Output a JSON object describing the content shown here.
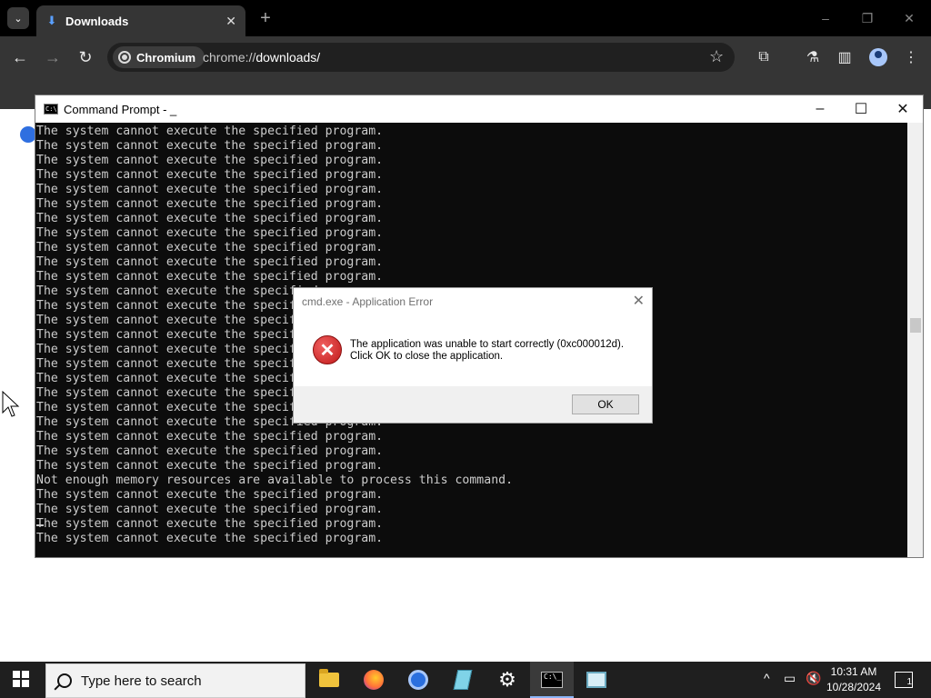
{
  "browser": {
    "tab_title": "Downloads",
    "tab_close": "✕",
    "new_tab": "+",
    "site_chip": "Chromium",
    "url_scheme": "chrome://",
    "url_path": "downloads/"
  },
  "cmd": {
    "title": "Command Prompt - _",
    "icon_text": "C:\\",
    "lines": [
      "The system cannot execute the specified program.",
      "The system cannot execute the specified program.",
      "The system cannot execute the specified program.",
      "The system cannot execute the specified program.",
      "The system cannot execute the specified program.",
      "The system cannot execute the specified program.",
      "The system cannot execute the specified program.",
      "The system cannot execute the specified program.",
      "The system cannot execute the specified program.",
      "The system cannot execute the specified program.",
      "The system cannot execute the specified program.",
      "The system cannot execute the specified program.",
      "The system cannot execute the specified program.",
      "The system cannot execute the specified program.",
      "The system cannot execute the specified program.",
      "The system cannot execute the specified program.",
      "The system cannot execute the specified program.",
      "The system cannot execute the specified program.",
      "The system cannot execute the specified program.",
      "The system cannot execute the specified program.",
      "The system cannot execute the specified program.",
      "The system cannot execute the specified program.",
      "The system cannot execute the specified program.",
      "The system cannot execute the specified program.",
      "Not enough memory resources are available to process this command.",
      "The system cannot execute the specified program.",
      "The system cannot execute the specified program.",
      "The system cannot execute the specified program.",
      "The system cannot execute the specified program."
    ]
  },
  "dialog": {
    "title": "cmd.exe - Application Error",
    "message_line1": "The application was unable to start correctly (0xc000012d).",
    "message_line2": "Click OK to close the application.",
    "ok_label": "OK"
  },
  "taskbar": {
    "search_placeholder": "Type here to search",
    "time": "10:31 AM",
    "date": "10/28/2024",
    "notification_count": "1"
  },
  "colors": {
    "cmd_background": "#0c0c0c",
    "cmd_text": "#cccccc",
    "error_red": "#c01818",
    "browser_frame": "#353535"
  }
}
